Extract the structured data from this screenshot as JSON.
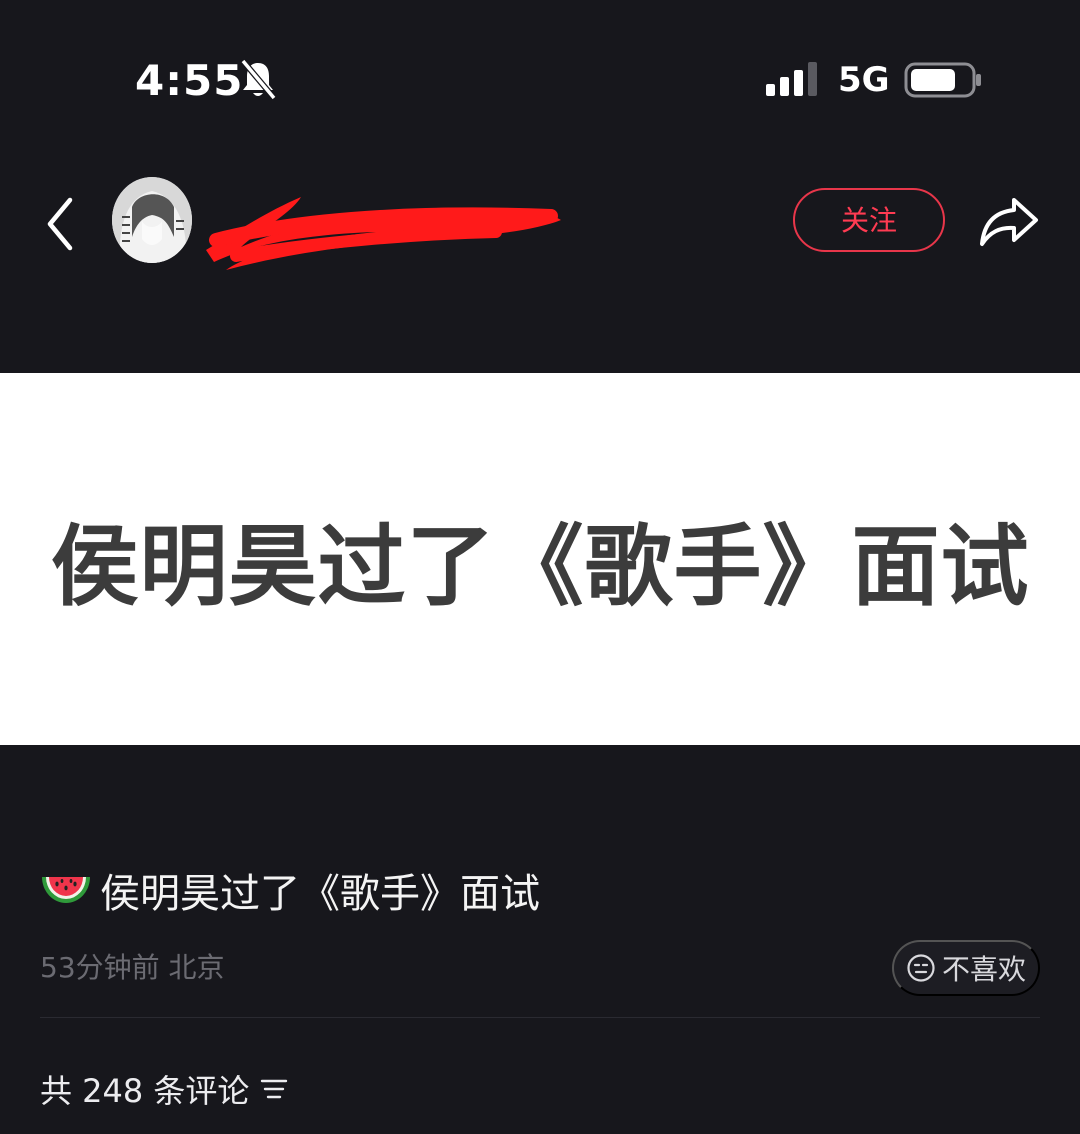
{
  "status_bar": {
    "time": "4:55",
    "network": "5G",
    "icons": [
      "bell-slash-icon",
      "signal-icon",
      "battery-icon"
    ]
  },
  "header": {
    "follow_label": "关注",
    "icons": [
      "back-chevron-icon",
      "share-icon"
    ]
  },
  "post": {
    "image_text": "侯明昊过了《歌手》面试",
    "title_emoji_icon": "watermelon-icon",
    "title": "侯明昊过了《歌手》面试",
    "time_ago": "53分钟前",
    "location": "北京",
    "dislike_label": "不喜欢"
  },
  "comments": {
    "label": "共 248 条评论"
  },
  "colors": {
    "background": "#17171c",
    "accent": "#ff3b52",
    "meta_text": "#6b6b72"
  }
}
